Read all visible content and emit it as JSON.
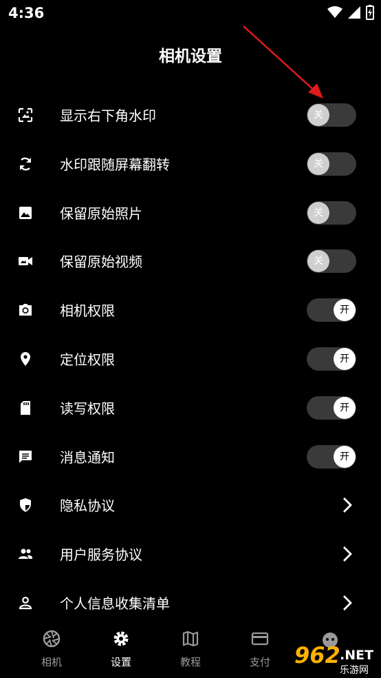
{
  "status_bar": {
    "time": "4:36"
  },
  "page": {
    "title": "相机设置"
  },
  "settings": [
    {
      "label": "显示右下角水印",
      "icon": "watermark-frame-icon",
      "type": "toggle",
      "state": "off",
      "state_text": "关"
    },
    {
      "label": "水印跟随屏幕翻转",
      "icon": "rotate-icon",
      "type": "toggle",
      "state": "off",
      "state_text": "关"
    },
    {
      "label": "保留原始照片",
      "icon": "image-icon",
      "type": "toggle",
      "state": "off",
      "state_text": "关"
    },
    {
      "label": "保留原始视频",
      "icon": "video-camera-icon",
      "type": "toggle",
      "state": "off",
      "state_text": "关"
    },
    {
      "label": "相机权限",
      "icon": "camera-icon",
      "type": "toggle",
      "state": "on",
      "state_text": "开"
    },
    {
      "label": "定位权限",
      "icon": "location-pin-icon",
      "type": "toggle",
      "state": "on",
      "state_text": "开"
    },
    {
      "label": "读写权限",
      "icon": "sd-card-icon",
      "type": "toggle",
      "state": "on",
      "state_text": "开"
    },
    {
      "label": "消息通知",
      "icon": "message-icon",
      "type": "toggle",
      "state": "on",
      "state_text": "开"
    },
    {
      "label": "隐私协议",
      "icon": "shield-icon",
      "type": "link"
    },
    {
      "label": "用户服务协议",
      "icon": "people-icon",
      "type": "link"
    },
    {
      "label": "个人信息收集清单",
      "icon": "person-icon",
      "type": "link"
    }
  ],
  "bottom_nav": [
    {
      "label": "相机",
      "icon": "aperture-icon",
      "active": false
    },
    {
      "label": "设置",
      "icon": "gear-icon",
      "active": true
    },
    {
      "label": "教程",
      "icon": "map-icon",
      "active": false
    },
    {
      "label": "支付",
      "icon": "card-icon",
      "active": false
    }
  ],
  "watermark": {
    "number": "962",
    "suffix": ".NET",
    "sub": "乐游网"
  },
  "colors": {
    "background": "#000000",
    "accent_arrow": "#e01b1b",
    "toggle_track": "#3a3a3a"
  }
}
